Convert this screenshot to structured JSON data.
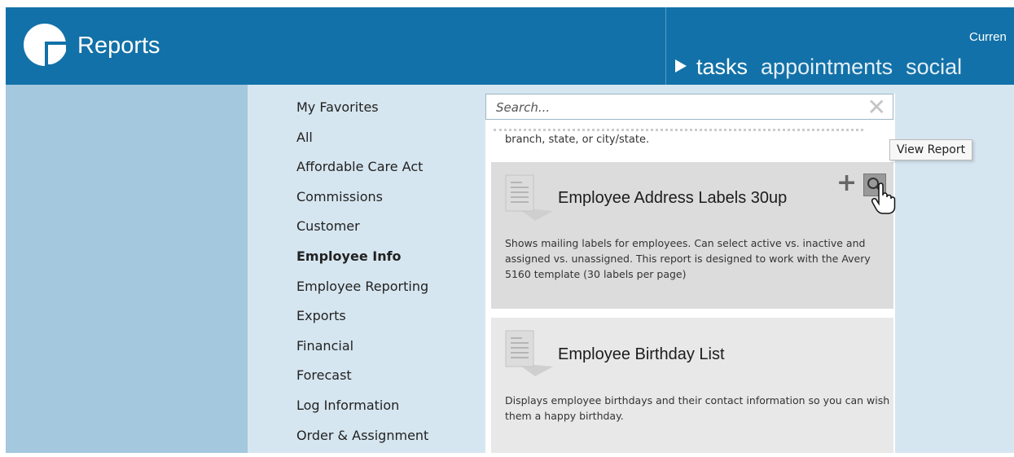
{
  "header": {
    "app_title": "Reports",
    "current_label": "Curren",
    "nav_tabs": [
      "tasks",
      "appointments",
      "social"
    ],
    "brand_color": "#1271a8"
  },
  "categories": [
    {
      "label": "My Favorites"
    },
    {
      "label": "All"
    },
    {
      "label": "Affordable Care Act"
    },
    {
      "label": "Commissions"
    },
    {
      "label": "Customer"
    },
    {
      "label": "Employee Info",
      "active": true
    },
    {
      "label": "Employee Reporting"
    },
    {
      "label": "Exports"
    },
    {
      "label": "Financial"
    },
    {
      "label": "Forecast"
    },
    {
      "label": "Log Information"
    },
    {
      "label": "Order & Assignment"
    }
  ],
  "search": {
    "placeholder": "Search...",
    "value": ""
  },
  "results": {
    "snippet": "branch, state, or city/state.",
    "cards": [
      {
        "title": "Employee Address Labels 30up",
        "description": "Shows mailing labels for employees.  Can select active vs. inactive and assigned vs. unassigned. This report is designed to work with the Avery 5160 template (30 labels per page)",
        "add_icon": "plus-icon",
        "view_icon": "magnifier-icon"
      },
      {
        "title": "Employee Birthday List",
        "description": "Displays employee birthdays and their contact information so you can wish them a happy birthday."
      }
    ]
  },
  "tooltip": "View Report"
}
